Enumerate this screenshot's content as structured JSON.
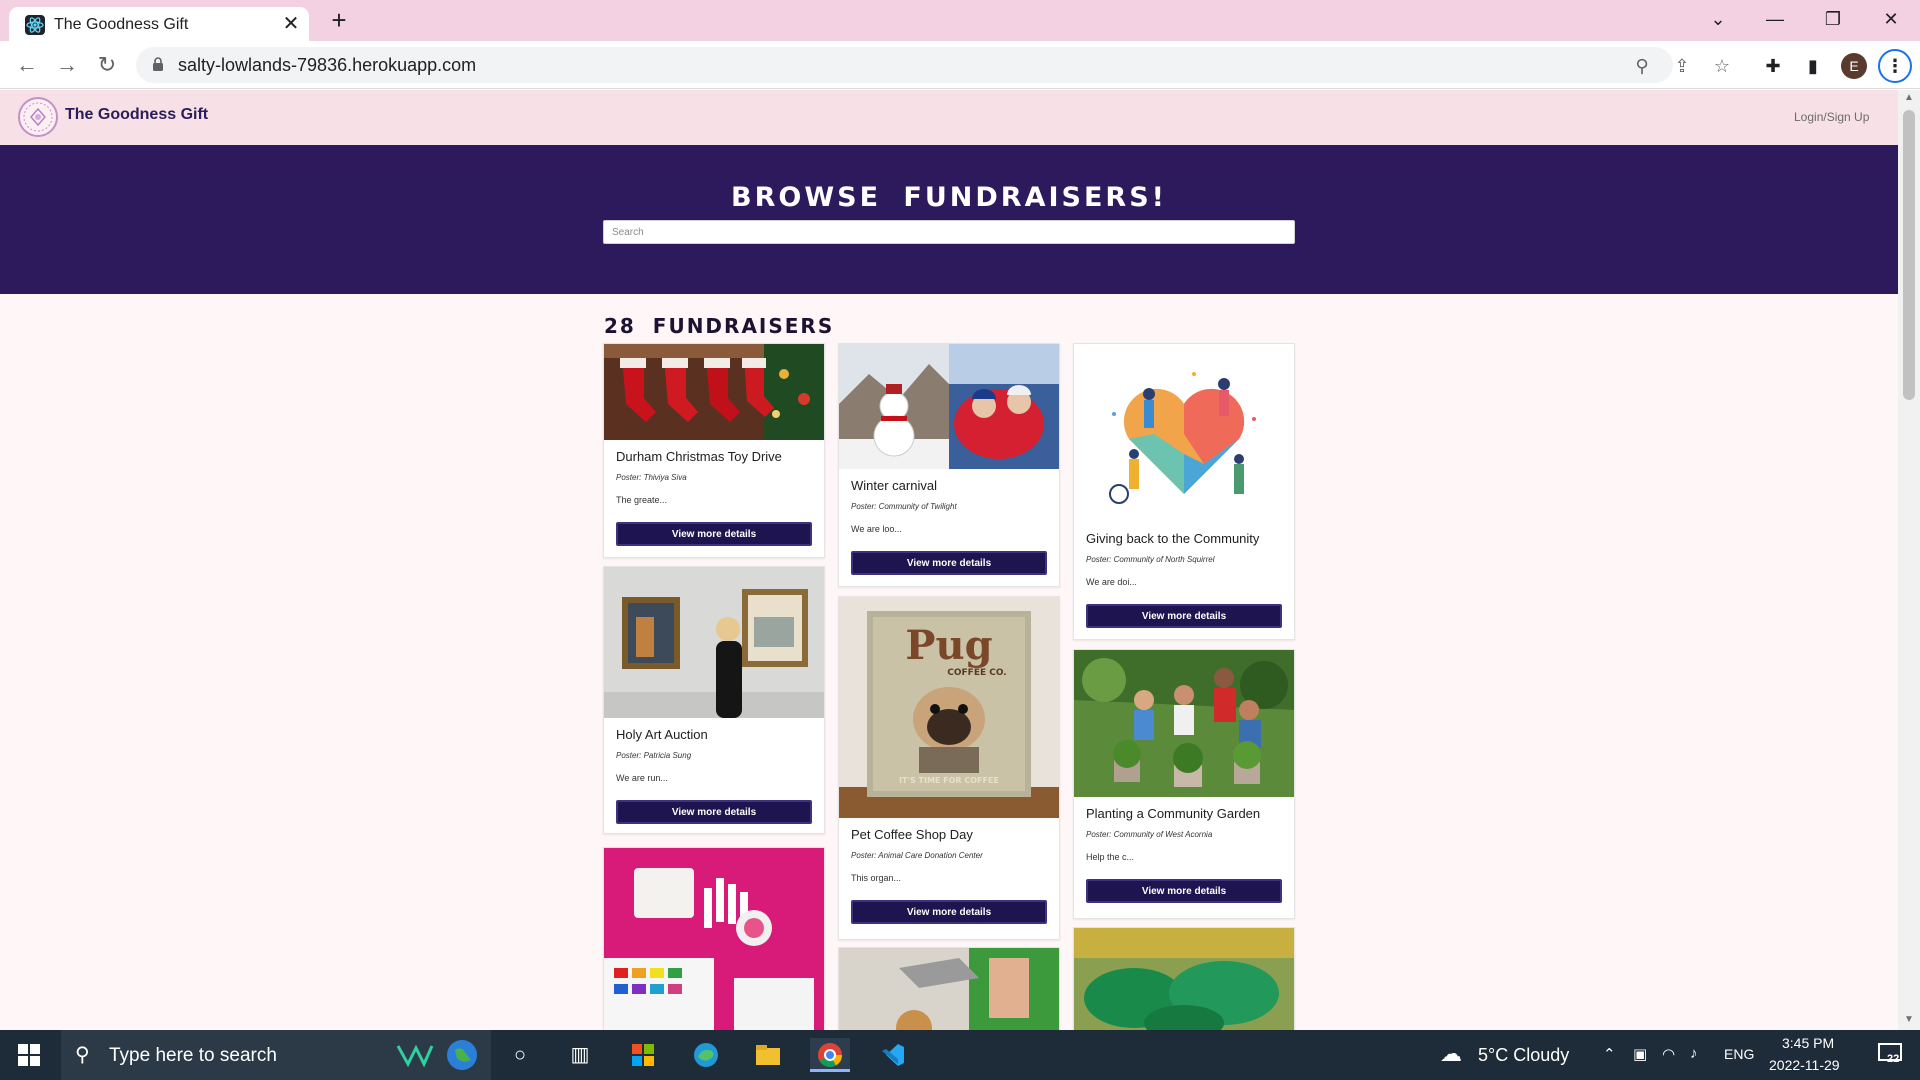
{
  "browser": {
    "tab_title": "The Goodness Gift",
    "tab_close": "✕",
    "new_tab": "+",
    "url": "salty-lowlands-79836.herokuapp.com",
    "profile_initial": "E",
    "window_controls": {
      "dropdown": "⌄",
      "minimize": "—",
      "restore": "❐",
      "close": "✕"
    }
  },
  "site": {
    "name": "The Goodness Gift",
    "login_link": "Login/Sign Up"
  },
  "hero": {
    "title": "BROWSE FUNDRAISERS!",
    "search_placeholder": "Search"
  },
  "listing": {
    "count_heading": "28 FUNDRAISERS",
    "button_label": "View more details",
    "cards": [
      {
        "title": "Durham Christmas Toy Drive",
        "poster": "Poster: Thiviya Siva",
        "description": "The greate..."
      },
      {
        "title": "Winter carnival",
        "poster": "Poster: Community of Twilight",
        "description": "We are loo..."
      },
      {
        "title": "Giving back to the Community",
        "poster": "Poster: Community of North Squirrel",
        "description": "We are doi..."
      },
      {
        "title": "Holy Art Auction",
        "poster": "Poster: Patricia Sung",
        "description": "We are run..."
      },
      {
        "title": "Pet Coffee Shop Day",
        "poster": "Poster: Animal Care Donation Center",
        "description": "This organ..."
      },
      {
        "title": "Planting a Community Garden",
        "poster": "Poster: Community of West Acornia",
        "description": "Help the c..."
      }
    ],
    "image_text": {
      "pug_title": "Pug",
      "pug_sub": "COFFEE CO.",
      "pug_footer": "IT'S TIME FOR COFFEE"
    }
  },
  "taskbar": {
    "search_placeholder": "Type here to search",
    "weather": "5°C  Cloudy",
    "language": "ENG",
    "time": "3:45 PM",
    "date": "2022-11-29",
    "notifications": "22"
  },
  "colors": {
    "hero_bg": "#2c1a5c",
    "button_bg": "#1e1550",
    "tab_strip": "#f3d1e2",
    "page_bg": "#fff6f8"
  }
}
